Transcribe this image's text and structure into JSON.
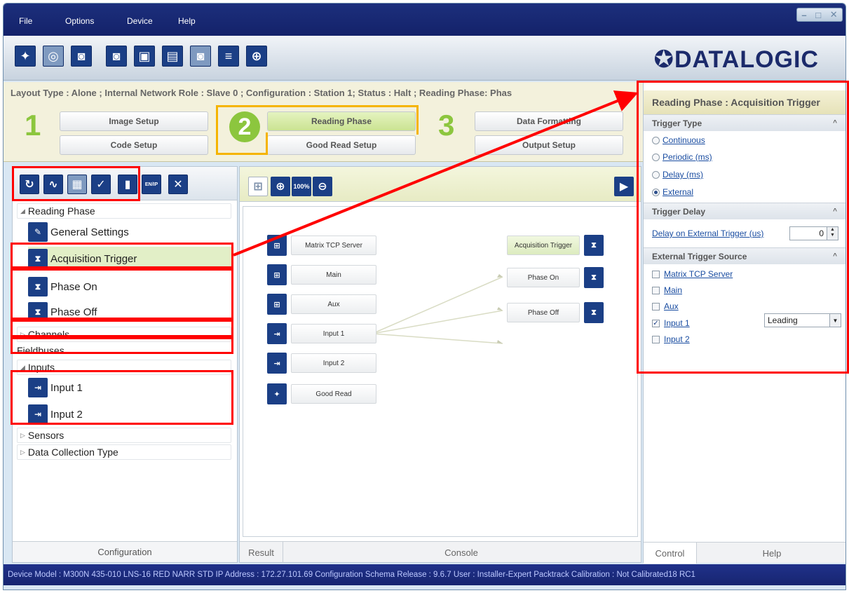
{
  "menu": [
    "File",
    "Options",
    "Device",
    "Help"
  ],
  "window_controls": [
    "–",
    "□",
    "✕"
  ],
  "toolbar": {
    "buttons": [
      "connect-icon",
      "discover-icon",
      "capture-icon",
      "capture-save-icon",
      "open-file-icon",
      "save-file-icon",
      "image-settings-icon",
      "ethernet-settings-icon",
      "crosshair-icon"
    ],
    "logo": "✪DATALOGIC"
  },
  "status_line": "Layout Type : Alone ; Internal Network Role : Slave 0 ; Configuration : Station 1; Status : Halt ; Reading Phase: Phas",
  "steps": {
    "step1": "1",
    "step2": "2",
    "step3": "3",
    "image_setup": "Image Setup",
    "code_setup": "Code Setup",
    "reading_phase": "Reading Phase",
    "good_read_setup": "Good Read Setup",
    "data_formatting": "Data Formatting",
    "output_setup": "Output Setup"
  },
  "left_panel": {
    "tree": {
      "reading_phase": "Reading Phase",
      "general_settings": "General Settings",
      "acquisition_trigger": "Acquisition Trigger",
      "phase_on": "Phase On",
      "phase_off": "Phase Off",
      "channels": "Channels",
      "fieldbuses": "Fieldbuses",
      "inputs": "Inputs",
      "input1": "Input 1",
      "input2": "Input 2",
      "sensors": "Sensors",
      "data_collection_type": "Data Collection Type"
    },
    "footer": "Configuration",
    "toolbar_icons": [
      "refresh-icon",
      "waveform-icon",
      "parameters-icon",
      "save-check-icon",
      "bookmark-icon",
      "enip-icon",
      "close-icon"
    ],
    "enip_label": "EN/IP"
  },
  "canvas": {
    "left_nodes": [
      "Matrix TCP Server",
      "Main",
      "Aux",
      "Input 1",
      "Input 2",
      "Good Read"
    ],
    "right_nodes": [
      "Acquisition Trigger",
      "Phase On",
      "Phase Off"
    ],
    "zoom_label": "100%"
  },
  "center_footer": {
    "result": "Result",
    "console": "Console"
  },
  "right_panel": {
    "title": "Reading Phase : Acquisition Trigger",
    "trigger_type": {
      "header": "Trigger Type",
      "options": [
        "Continuous",
        "Periodic (ms)",
        "Delay (ms)",
        "External"
      ],
      "selected": "External"
    },
    "trigger_delay": {
      "header": "Trigger Delay",
      "label": "Delay on External Trigger (us)",
      "value": "0"
    },
    "external_source": {
      "header": "External Trigger Source",
      "items": [
        "Matrix TCP Server",
        "Main",
        "Aux",
        "Input 1",
        "Input 2"
      ],
      "checked": "Input 1",
      "edge": "Leading"
    },
    "footer": {
      "control": "Control",
      "help": "Help"
    }
  },
  "statusbar": "Device Model : M300N 435-010 LNS-16 RED NARR STD   IP Address :  172.27.101.69   Configuration Schema Release :  9.6.7   User : Installer-Expert   Packtrack Calibration : Not Calibrated18 RC1",
  "colors": {
    "accent_green": "#8cc63e",
    "highlight_red": "#ff0000",
    "highlight_orange": "#f5b400",
    "brand_blue": "#1b3f86"
  }
}
